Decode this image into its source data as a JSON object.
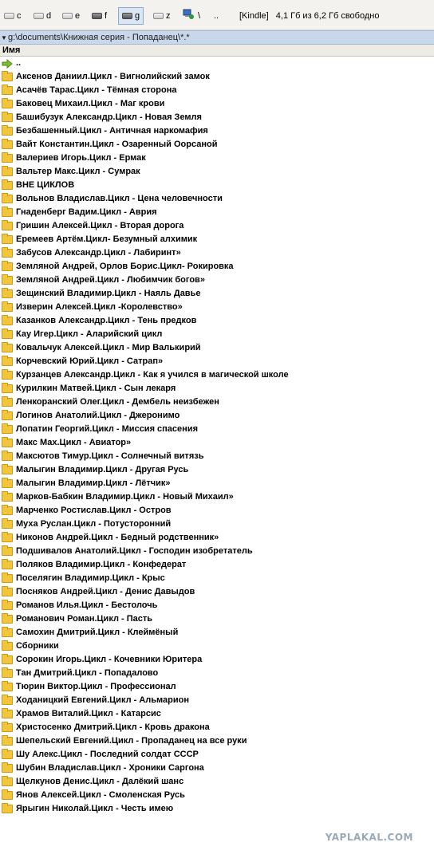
{
  "drives": [
    {
      "letter": "c",
      "icon": "drive-icon",
      "active": false
    },
    {
      "letter": "d",
      "icon": "drive-icon",
      "active": false
    },
    {
      "letter": "e",
      "icon": "drive-icon",
      "active": false
    },
    {
      "letter": "f",
      "icon": "removable-drive-icon",
      "active": false
    },
    {
      "letter": "g",
      "icon": "removable-drive-icon",
      "active": true
    },
    {
      "letter": "z",
      "icon": "drive-icon",
      "active": false
    }
  ],
  "toolbar": {
    "network_icon": "network-icon",
    "root_label": "\\",
    "up_label": "..",
    "volume_label": "[Kindle]",
    "free_space": "4,1 Гб из 6,2 Гб свободно"
  },
  "path": {
    "text": "g:\\documents\\Книжная серия - Попаданец\\*.*"
  },
  "column": {
    "name_header": "Имя"
  },
  "up_entry": "..",
  "folders": [
    "Аксенов Даниил.Цикл - Вигнолийский замок",
    "Асачёв Тарас.Цикл - Тёмная сторона",
    "Баковец Михаил.Цикл - Маг крови",
    "Башибузук Александр.Цикл - Новая Земля",
    "Безбашенный.Цикл - Античная наркомафия",
    "Вайт Константин.Цикл - Озаренный Оорсаной",
    "Валериев Игорь.Цикл - Ермак",
    "Вальтер Макс.Цикл - Сумрак",
    "ВНЕ ЦИКЛОВ",
    "Вольнов Владислав.Цикл - Цена человечности",
    "Гнаденберг Вадим.Цикл - Аврия",
    "Гришин Алексей.Цикл - Вторая дорога",
    "Еремеев Артём.Цикл- Безумный алхимик",
    "Забусов Александр.Цикл - Лабиринт»",
    "Земляной Андрей, Орлов Борис.Цикл- Рокировка",
    "Земляной Андрей.Цикл - Любимчик богов»",
    "Зещинский Владимир.Цикл - Наяль Давье",
    "Изверин Алексей.Цикл -Королевство»",
    "Казанков Александр.Цикл - Тень предков",
    "Кау Игер.Цикл - Аларийский цикл",
    "Ковальчук Алексей.Цикл - Мир Валькирий",
    "Корчевский Юрий.Цикл - Сатрап»",
    "Курзанцев Александр.Цикл - Как я учился в магической школе",
    "Курилкин Матвей.Цикл - Сын лекаря",
    "Ленкоранский Олег.Цикл - Дембель неизбежен",
    "Логинов Анатолий.Цикл - Джеронимо",
    "Лопатин Георгий.Цикл - Миссия спасения",
    "Макс Мах.Цикл - Авиатор»",
    "Максютов Тимур.Цикл - Солнечный витязь",
    "Малыгин Владимир.Цикл - Другая Русь",
    "Малыгин Владимир.Цикл - Лётчик»",
    "Марков-Бабкин Владимир.Цикл - Новый Михаил»",
    "Марченко Ростислав.Цикл - Остров",
    "Муха Руслан.Цикл - Потусторонний",
    "Никонов Андрей.Цикл - Бедный родственник»",
    "Подшивалов Анатолий.Цикл - Господин изобретатель",
    "Поляков Владимир.Цикл - Конфедерат",
    "Поселягин Владимир.Цикл - Крыс",
    "Посняков Андрей.Цикл - Денис Давыдов",
    "Романов Илья.Цикл - Бестолочь",
    "Романович Роман.Цикл - Пасть",
    "Самохин Дмитрий.Цикл - Клеймёный",
    "Сборники",
    "Сорокин Игорь.Цикл - Кочевники Юритера",
    "Тан Дмитрий.Цикл - Попадалово",
    "Тюрин Виктор.Цикл  - Профессионал",
    "Ходаницкий Евгений.Цикл - Альмарион",
    "Храмов Виталий.Цикл - Катарсис",
    "Христосенко Дмитрий.Цикл - Кровь дракона",
    "Шепельский Евгений.Цикл - Пропаданец на все руки",
    "Шу Алекс.Цикл - Последний солдат СССР",
    "Шубин Владислав.Цикл - Хроники Саргона",
    "Щелкунов Денис.Цикл - Далёкий шанс",
    "Янов Алексей.Цикл - Смоленская Русь",
    "Ярыгин Николай.Цикл - Честь имею"
  ],
  "watermark": "YAPLAKAL.COM",
  "colors": {
    "folder": "#f1c63d",
    "path_bar": "#c8d7ea",
    "active_drive": "#dbe6f5"
  }
}
